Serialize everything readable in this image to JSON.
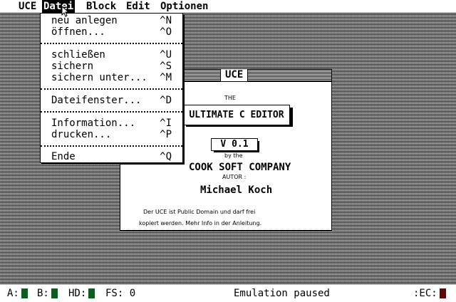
{
  "menubar": {
    "items": [
      "UCE",
      "Datei",
      "Block",
      "Edit",
      "Optionen"
    ],
    "active": "Datei"
  },
  "dropdown": {
    "items": [
      {
        "label": "neu anlegen",
        "key": "^N"
      },
      {
        "label": "öffnen...",
        "key": "^O"
      },
      {
        "label": "schließen",
        "key": "^U"
      },
      {
        "label": "sichern",
        "key": "^S"
      },
      {
        "label": "sichern unter...",
        "key": "^M"
      },
      {
        "label": "Dateifenster...",
        "key": "^D"
      },
      {
        "label": "Information...",
        "key": "^I"
      },
      {
        "label": "drucken...",
        "key": "^P"
      },
      {
        "label": "Ende",
        "key": "^Q"
      }
    ]
  },
  "about": {
    "title": "UCE",
    "the": "THE",
    "product": "ULTIMATE C EDITOR",
    "version": "V 0.1",
    "by_the": "by the",
    "company": "COOK SOFT COMPANY",
    "autor": "AUTOR :",
    "author": "Michael Koch",
    "note1": "Der UCE ist Public Domain und darf frei",
    "note2": "kopiert werden. Mehr Info in der Anleitung."
  },
  "statusbar": {
    "drive_a": "A:",
    "drive_b": "B:",
    "hd": "HD:",
    "fs": "FS: 0",
    "status": "Emulation paused",
    "ec": ":EC:"
  },
  "colors": {
    "led_green": "#0b5e1e",
    "led_red": "#6b0000"
  }
}
